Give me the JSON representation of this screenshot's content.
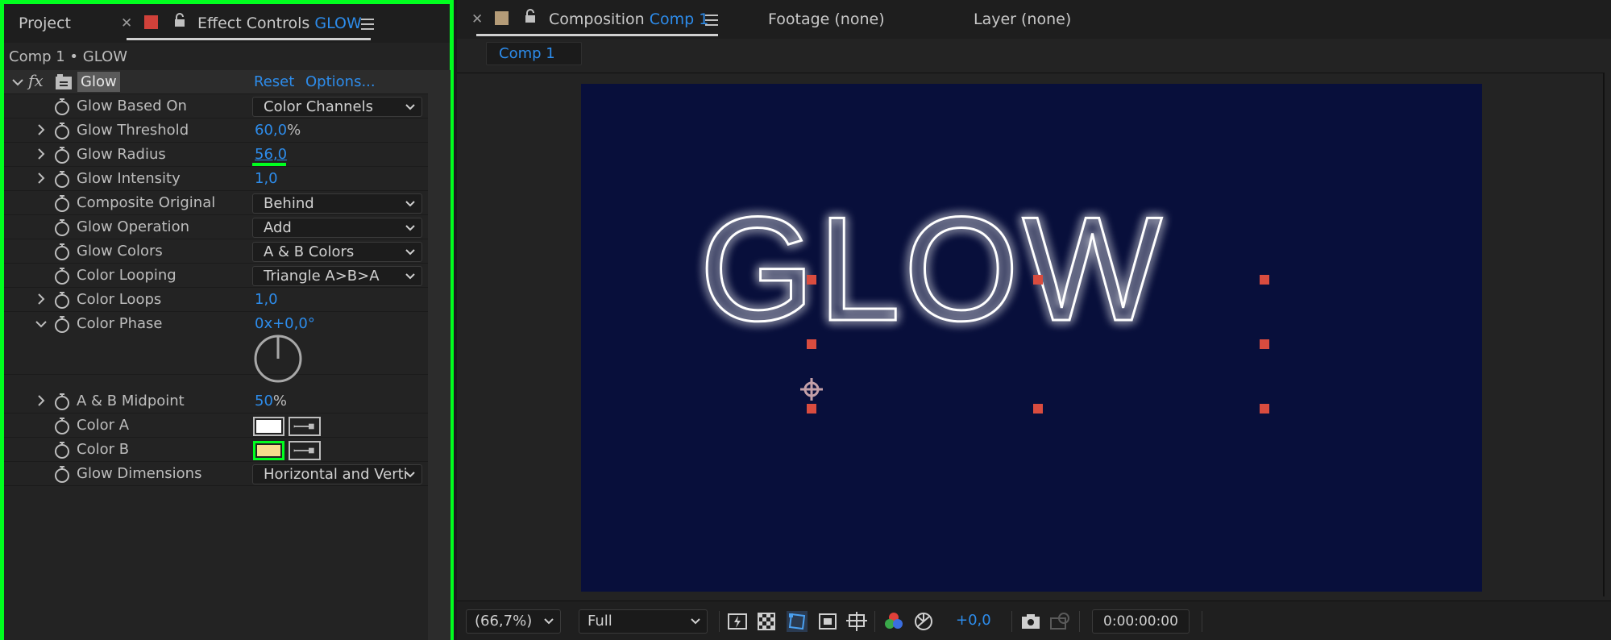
{
  "left_panel": {
    "tabs": {
      "project": "Project",
      "effect_controls_prefix": "Effect Controls",
      "effect_controls_layer": "GLOW"
    },
    "breadcrumb": "Comp 1 • GLOW",
    "effect": {
      "fx_label": "fx",
      "name": "Glow",
      "reset": "Reset",
      "options": "Options..."
    },
    "properties": [
      {
        "label": "Glow Based On",
        "type": "dropdown",
        "value": "Color Channels"
      },
      {
        "label": "Glow Threshold",
        "type": "number",
        "value": "60,0",
        "unit": "%"
      },
      {
        "label": "Glow Radius",
        "type": "number",
        "value": "56,0",
        "highlighted": true
      },
      {
        "label": "Glow Intensity",
        "type": "number",
        "value": "1,0"
      },
      {
        "label": "Composite Original",
        "type": "dropdown",
        "value": "Behind"
      },
      {
        "label": "Glow Operation",
        "type": "dropdown",
        "value": "Add"
      },
      {
        "label": "Glow Colors",
        "type": "dropdown",
        "value": "A & B Colors"
      },
      {
        "label": "Color Looping",
        "type": "dropdown",
        "value": "Triangle A>B>A"
      },
      {
        "label": "Color Loops",
        "type": "number",
        "value": "1,0"
      },
      {
        "label": "Color Phase",
        "type": "angle",
        "value": "0x+0,0°"
      },
      {
        "label": "A & B Midpoint",
        "type": "number",
        "value": "50",
        "unit": "%"
      },
      {
        "label": "Color A",
        "type": "color",
        "color": "#ffffff"
      },
      {
        "label": "Color B",
        "type": "color",
        "color": "#f5dc8e",
        "highlighted": true
      },
      {
        "label": "Glow Dimensions",
        "type": "dropdown",
        "value": "Horizontal and Verti"
      }
    ],
    "highlight_color": "#00ff1f"
  },
  "right_panel": {
    "tabs": {
      "composition_prefix": "Composition",
      "composition_name": "Comp 1",
      "footage": "Footage (none)",
      "layer": "Layer (none)"
    },
    "subtab": "Comp 1",
    "canvas": {
      "background": "#080f3b",
      "text": "GLOW"
    },
    "bottom_bar": {
      "zoom": "(66,7%)",
      "resolution": "Full",
      "exposure": "+0,0",
      "timecode": "0:00:00:00"
    }
  }
}
